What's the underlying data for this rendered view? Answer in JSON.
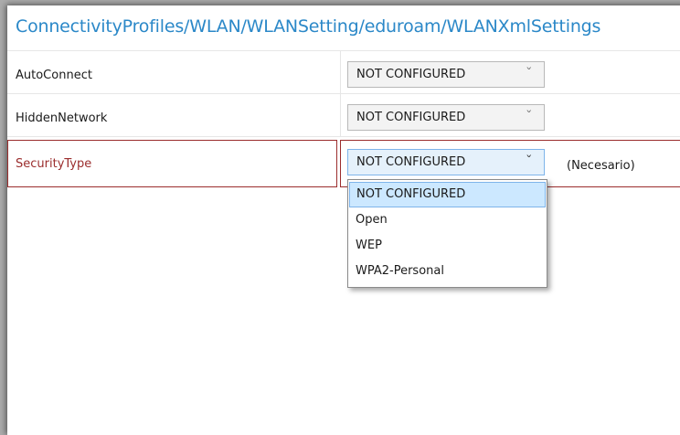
{
  "header": {
    "path": "ConnectivityProfiles/WLAN/WLANSetting/eduroam/WLANXmlSettings"
  },
  "settings": [
    {
      "label": "AutoConnect",
      "value": "NOT CONFIGURED"
    },
    {
      "label": "HiddenNetwork",
      "value": "NOT CONFIGURED"
    },
    {
      "label": "SecurityType",
      "value": "NOT CONFIGURED",
      "note": "(Necesario)"
    }
  ],
  "dropdown": {
    "options": [
      "NOT CONFIGURED",
      "Open",
      "WEP",
      "WPA2-Personal"
    ],
    "selected": "NOT CONFIGURED"
  },
  "colors": {
    "header": "#2b88c8",
    "error": "#9b2d2d",
    "selected_bg": "#cce8ff"
  }
}
